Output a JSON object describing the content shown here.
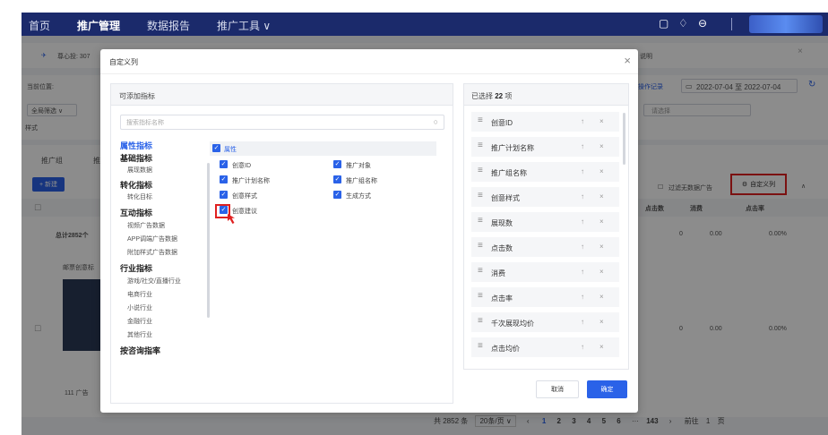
{
  "topnav": {
    "items": [
      "首页",
      "推广管理",
      "数据报告",
      "推广工具 ∨"
    ],
    "active_index": 1,
    "brand_color": "#1b2a6b"
  },
  "background": {
    "account_text": "尊心投: 307",
    "location_label": "当前位置:",
    "filter_all": "全局筛选 ∨",
    "style_label": "样式",
    "tab_1": "推广组",
    "tab_2": "推",
    "new_button": "+ 新建",
    "date_range": "2022-07-04 至 2022-07-04",
    "change_log": "操作记录",
    "filter_placeholder": "请选择",
    "filter_empty_data": "过滤无数据广告",
    "custom_columns_button": "自定义列",
    "col_clicks": "点击数",
    "col_cost": "消费",
    "col_ctr": "点击率",
    "total_label": "总计2852个",
    "summary_clicks": "0",
    "summary_cost": "0.00",
    "summary_ctr": "0.00%",
    "row_clicks": "0",
    "row_cost": "0.00",
    "row_ctr": "0.00%",
    "row_name": "邮票创意标",
    "row_bottom": "111 广告",
    "pager": {
      "total": "共 2852 条",
      "page_size": "20条/页",
      "pages": [
        "1",
        "2",
        "3",
        "4",
        "5",
        "6",
        "···",
        "143"
      ],
      "current_page": "1",
      "goto_label": "前往",
      "goto_value": "1",
      "page_suffix": "页"
    }
  },
  "modal": {
    "title": "自定义列",
    "available_title": "可添加指标",
    "search_placeholder": "搜索指标名称",
    "categories": [
      {
        "group": "属性指标",
        "active": true,
        "items": []
      },
      {
        "group": "基础指标",
        "items": [
          "展现数据"
        ]
      },
      {
        "group": "转化指标",
        "items": [
          "转化目标"
        ]
      },
      {
        "group": "互动指标",
        "items": [
          "视频广告数据",
          "APP调端广告数据",
          "附加样式广告数据"
        ]
      },
      {
        "group": "行业指标",
        "items": [
          "游戏/社交/直播行业",
          "电商行业",
          "小说行业",
          "金融行业",
          "其他行业"
        ]
      },
      {
        "group": "按咨询指率",
        "items": []
      }
    ],
    "attribute_group_label": "属性",
    "checkboxes": [
      {
        "label": "创意ID",
        "checked": true
      },
      {
        "label": "推广对象",
        "checked": true
      },
      {
        "label": "推广计划名称",
        "checked": true
      },
      {
        "label": "推广组名称",
        "checked": true
      },
      {
        "label": "创意样式",
        "checked": true
      },
      {
        "label": "生成方式",
        "checked": true
      },
      {
        "label": "创意建议",
        "checked": true
      }
    ],
    "selected_prefix": "已选择",
    "selected_count": "22",
    "selected_suffix": "项",
    "selected_items": [
      "创意ID",
      "推广计划名称",
      "推广组名称",
      "创意样式",
      "展现数",
      "点击数",
      "消费",
      "点击率",
      "千次展现均价",
      "点击均价"
    ],
    "cancel_label": "取消",
    "ok_label": "确定",
    "accent_color": "#2a62e8",
    "highlight_color": "#e02020"
  }
}
